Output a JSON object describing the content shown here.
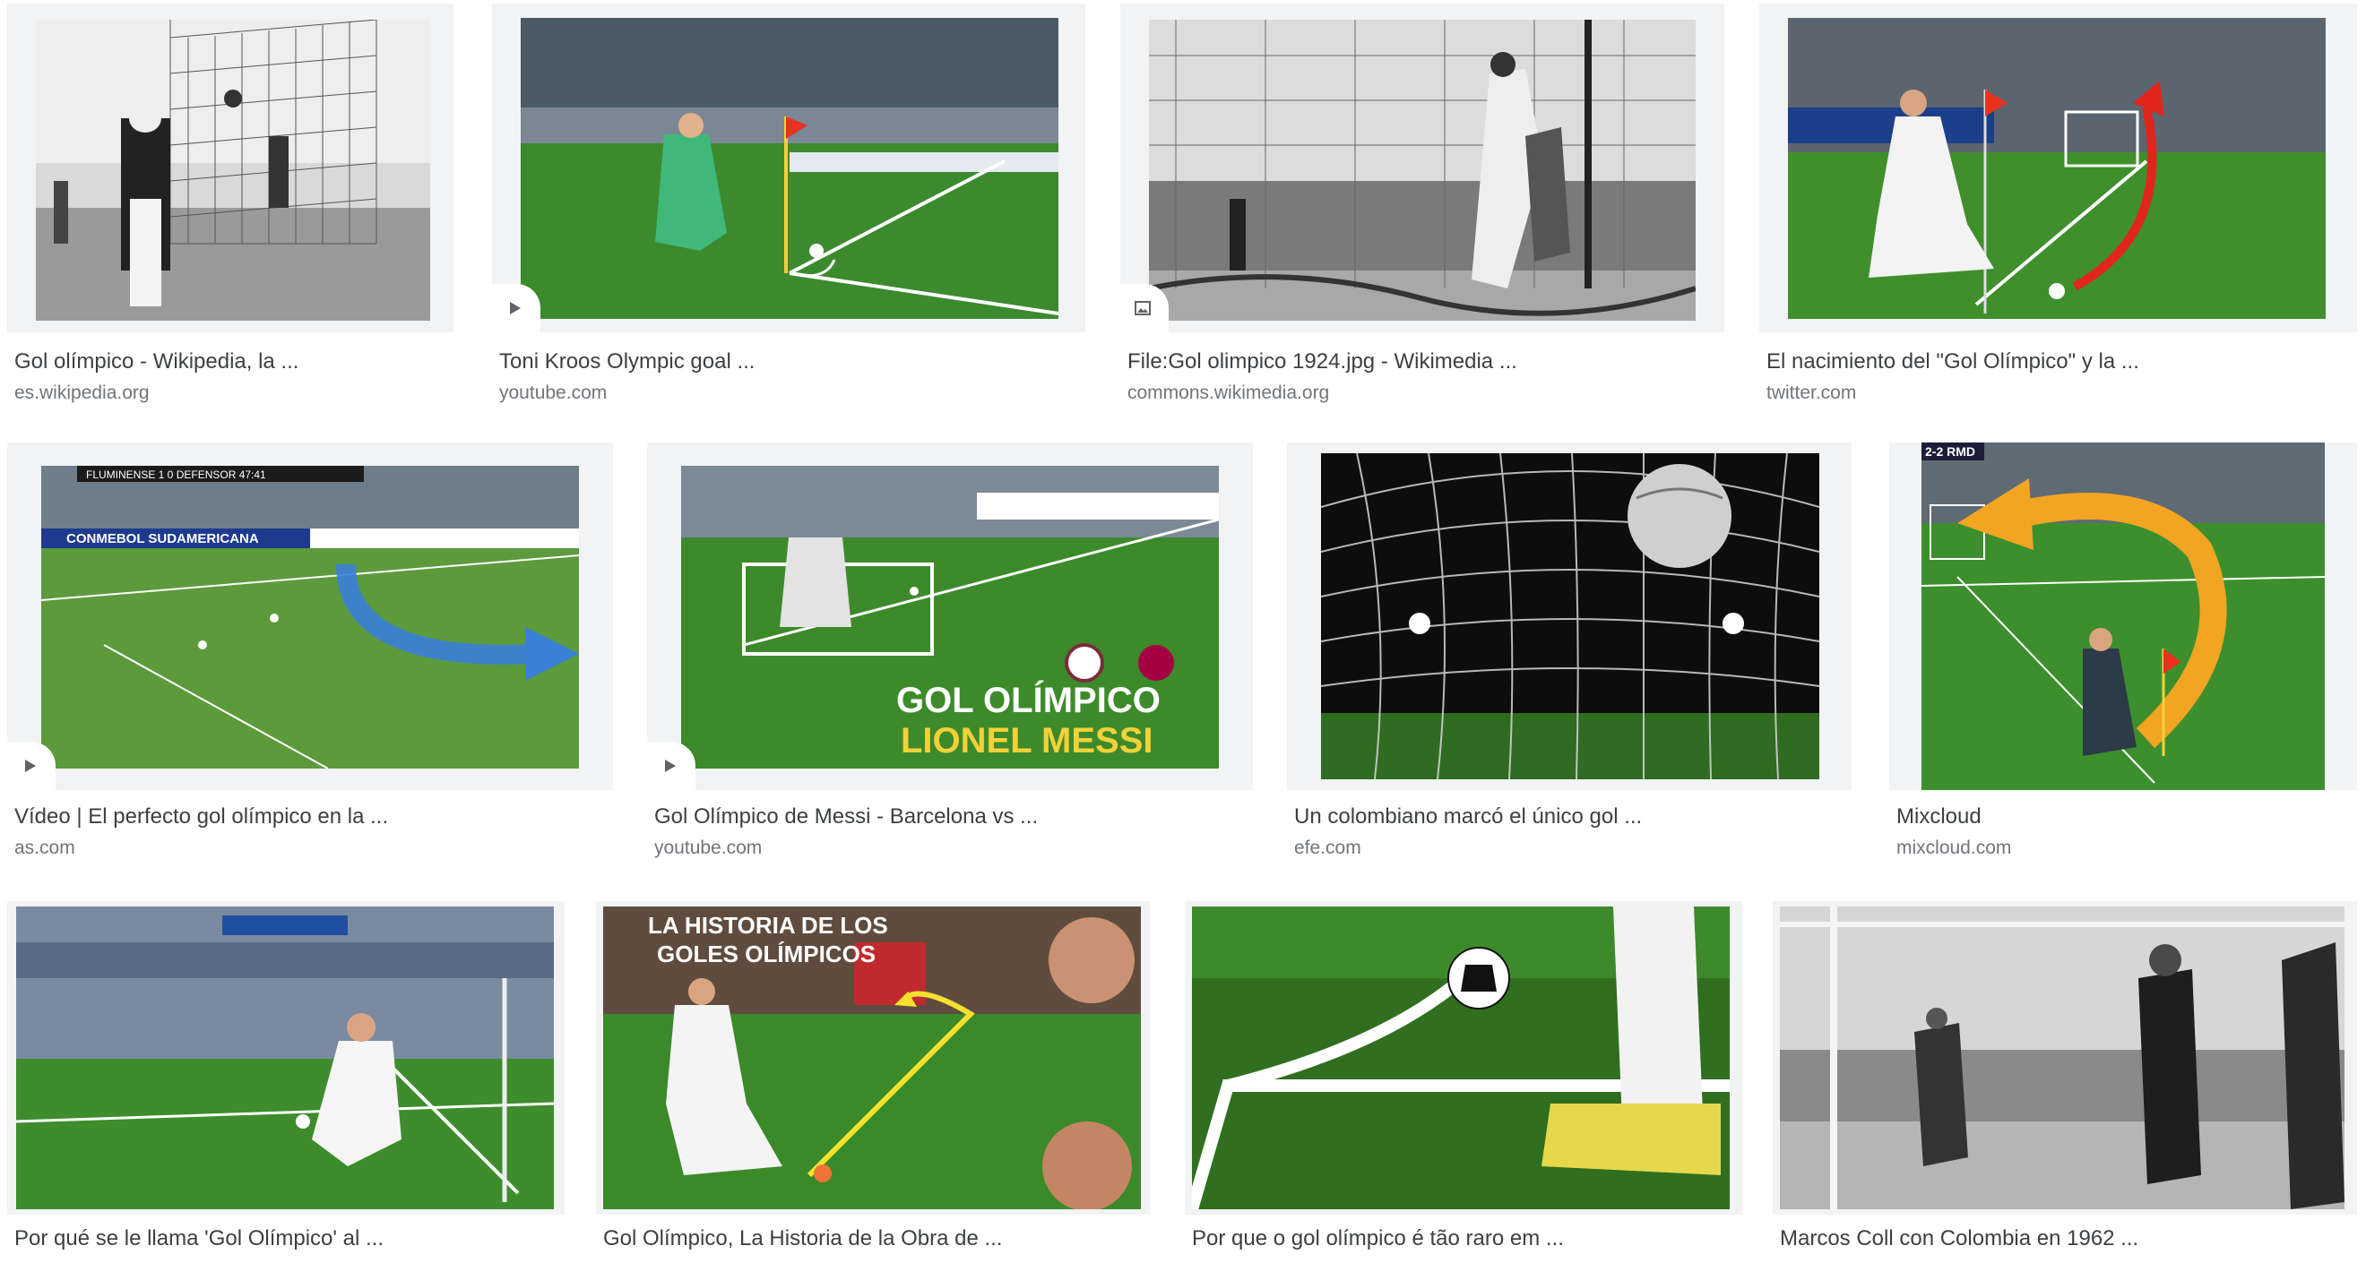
{
  "results": [
    {
      "title": "Gol olímpico - Wikipedia, la ...",
      "source": "es.wikipedia.org",
      "thumb": "bw-goal-net",
      "badge": ""
    },
    {
      "title": "Toni Kroos Olympic goal ...",
      "source": "youtube.com",
      "thumb": "corner-kick-pitch",
      "badge": "play-icon"
    },
    {
      "title": "File:Gol olimpico 1924.jpg - Wikimedia ...",
      "source": "commons.wikimedia.org",
      "thumb": "bw-goal-crowd",
      "badge": "image-icon"
    },
    {
      "title": "El nacimiento del \"Gol Olímpico\" y la ...",
      "source": "twitter.com",
      "thumb": "corner-kick-arrow",
      "badge": ""
    },
    {
      "title": "Vídeo | El perfecto gol olímpico en la ...",
      "source": "as.com",
      "thumb": "tv-broadcast-arrow",
      "badge": "play-icon",
      "overlay": {
        "scoreboard": "FLUMINENSE  1 0  DEFENSOR   47:41",
        "ad": "CONMEBOL SUDAMERICANA"
      }
    },
    {
      "title": "Gol Olímpico de Messi - Barcelona vs ...",
      "source": "youtube.com",
      "thumb": "messi-gol-olimpico",
      "badge": "play-icon",
      "overlay": {
        "line1": "GOL OLÍMPICO",
        "line2": "LIONEL MESSI"
      }
    },
    {
      "title": "Un colombiano marcó el único gol ...",
      "source": "efe.com",
      "thumb": "ball-in-net-night",
      "badge": ""
    },
    {
      "title": "Mixcloud",
      "source": "mixcloud.com",
      "thumb": "game-corner-arrow",
      "badge": "",
      "overlay": {
        "score": "2-2  RMD"
      }
    },
    {
      "title": "Por qué se le llama 'Gol Olímpico' al ...",
      "source": "",
      "thumb": "stadium-corner-kick",
      "badge": ""
    },
    {
      "title": "Gol Olímpico, La Historia de la Obra de ...",
      "source": "",
      "thumb": "historia-goles-olimpicos",
      "badge": "",
      "overlay": {
        "line1": "LA HISTORIA DE LOS",
        "line2": "GOLES OLÍMPICOS"
      }
    },
    {
      "title": "Por que o gol olímpico é tão raro em ...",
      "source": "",
      "thumb": "corner-arc-ball-closeup",
      "badge": ""
    },
    {
      "title": "Marcos Coll con Colombia en 1962 ...",
      "source": "",
      "thumb": "bw-goalkeeper-1962",
      "badge": ""
    }
  ],
  "colors": {
    "title": "#3c4043",
    "source": "#70757a",
    "tile_bg": "#f1f3f4",
    "pitch": "#3f8f2c"
  }
}
